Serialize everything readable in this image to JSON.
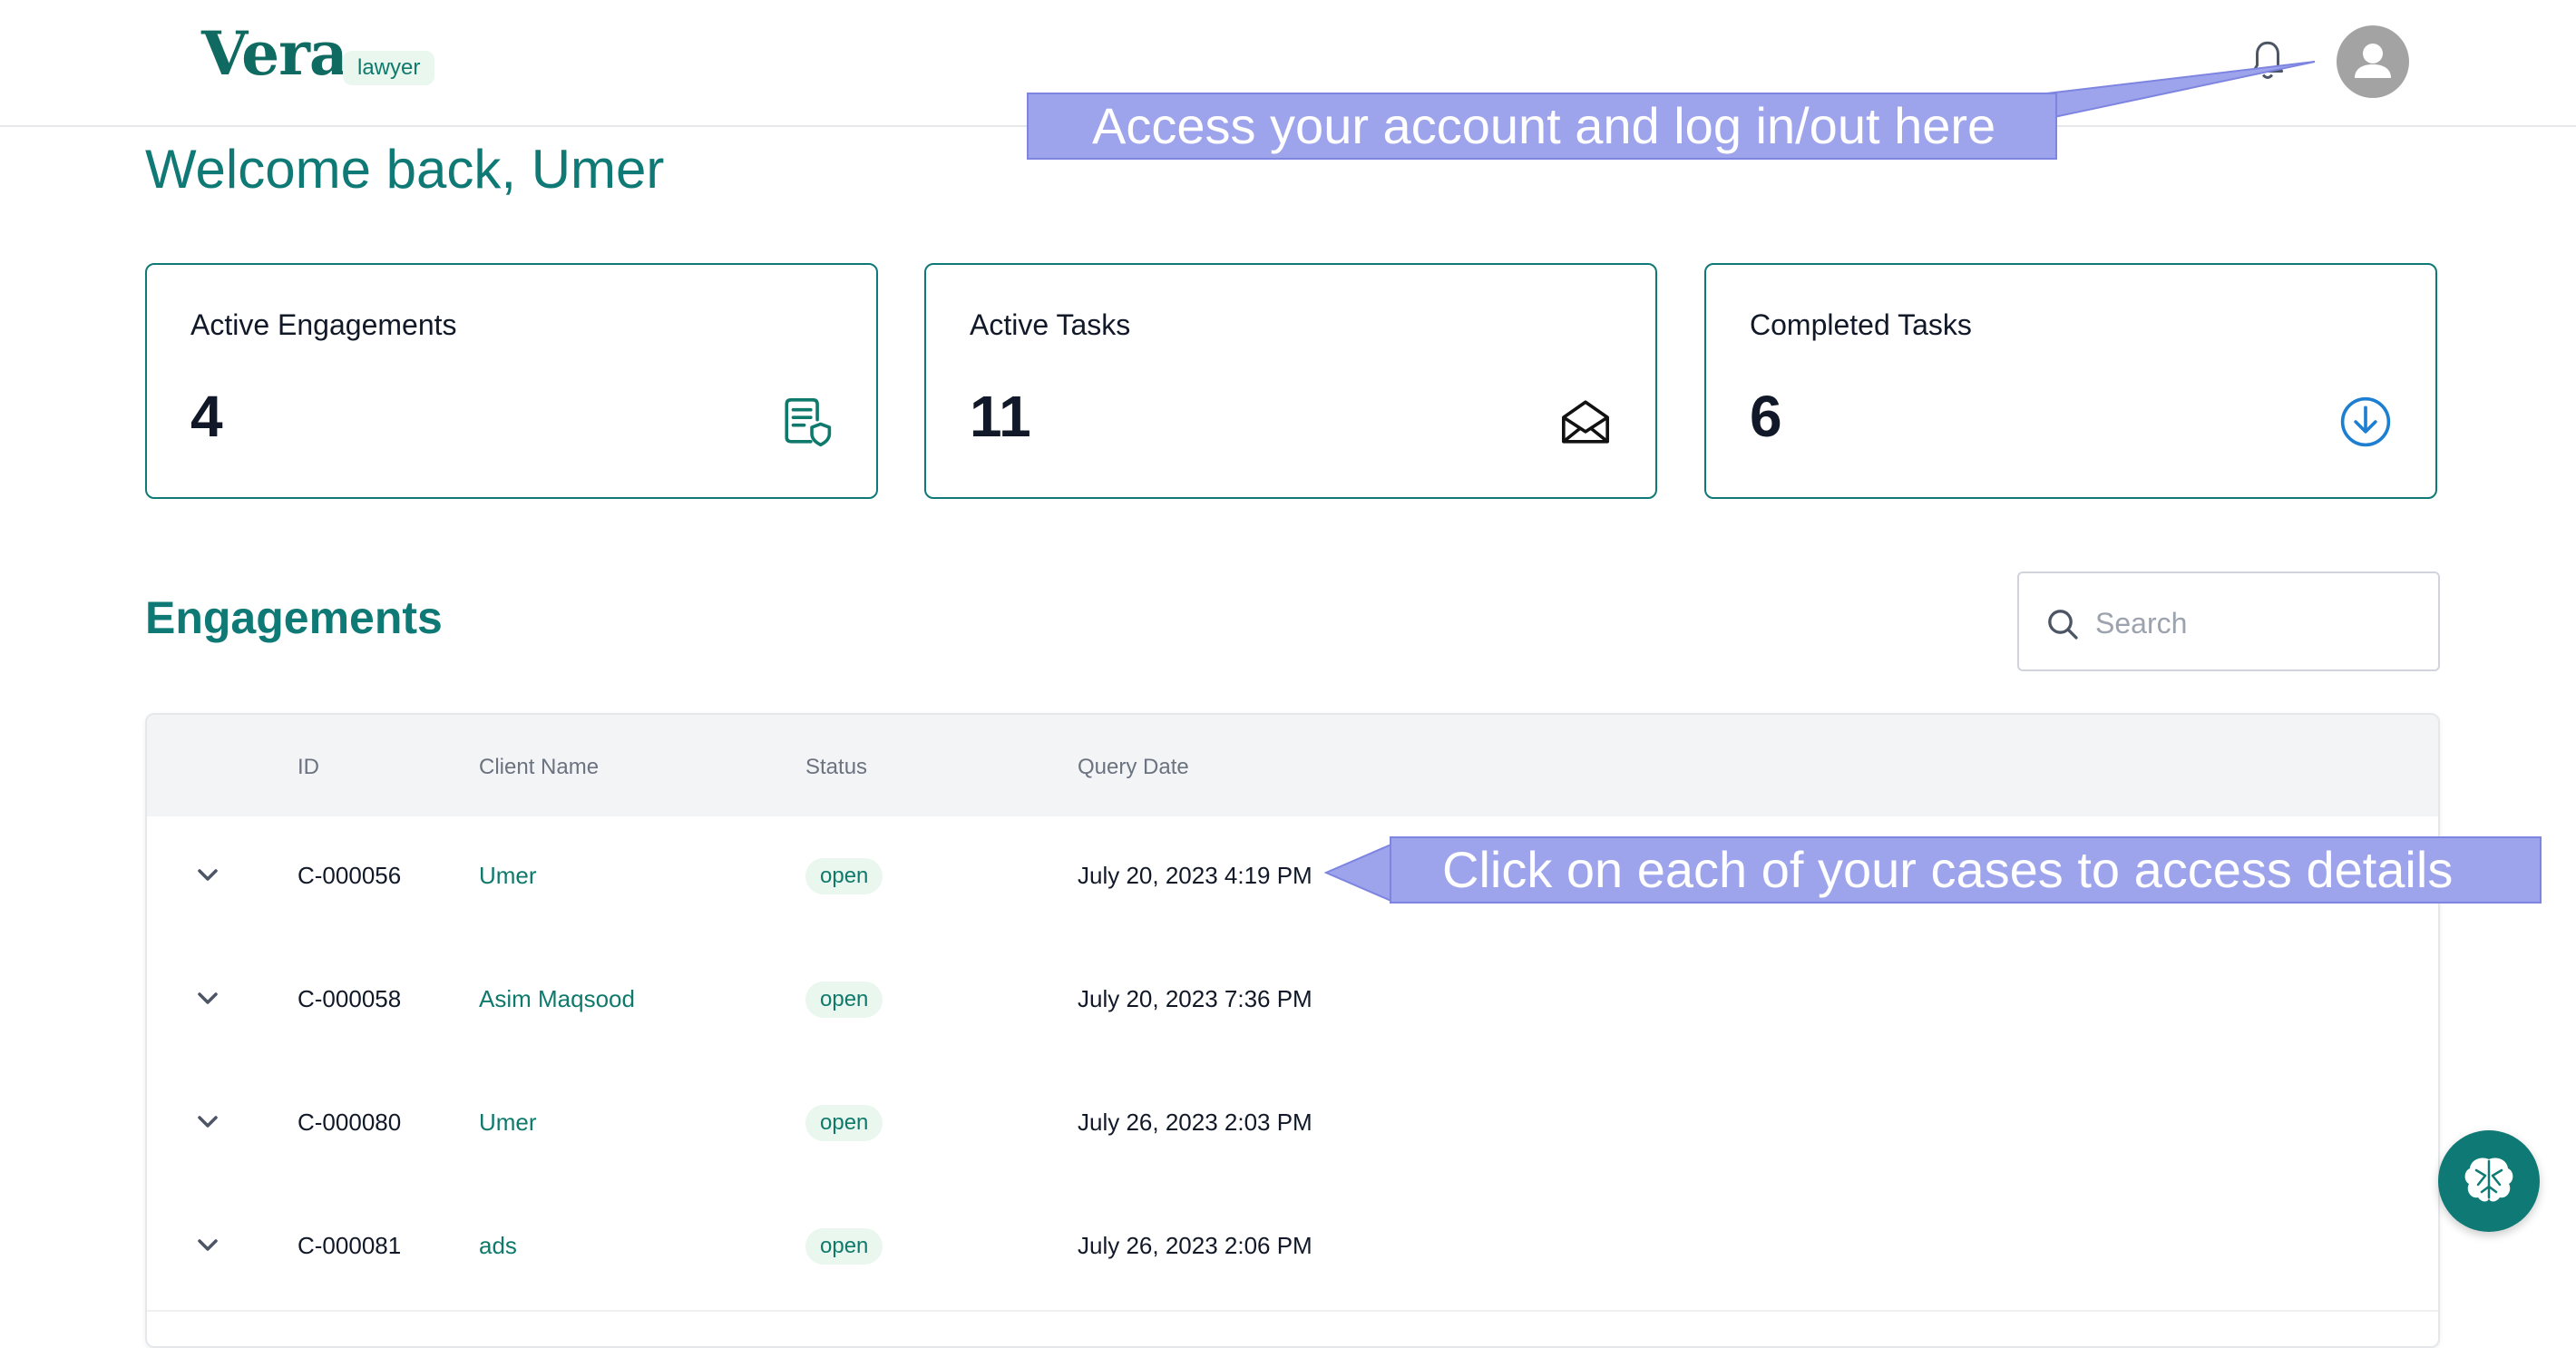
{
  "header": {
    "logo": "Vera",
    "role_badge": "lawyer",
    "bell_icon": "bell-icon",
    "avatar_icon": "user-avatar-icon"
  },
  "welcome": "Welcome back, Umer",
  "stats": [
    {
      "title": "Active Engagements",
      "value": "4",
      "icon": "document-shield-icon",
      "icon_color": "#0f7a6c"
    },
    {
      "title": "Active Tasks",
      "value": "11",
      "icon": "open-envelope-icon",
      "icon_color": "#111111"
    },
    {
      "title": "Completed Tasks",
      "value": "6",
      "icon": "download-circle-icon",
      "icon_color": "#1d7fd1"
    }
  ],
  "engagements": {
    "title": "Engagements",
    "search": {
      "placeholder": "Search",
      "value": ""
    },
    "columns": [
      "ID",
      "Client Name",
      "Status",
      "Query Date"
    ],
    "rows": [
      {
        "id": "C-000056",
        "client": "Umer",
        "status": "open",
        "date": "July 20, 2023 4:19 PM"
      },
      {
        "id": "C-000058",
        "client": "Asim Maqsood",
        "status": "open",
        "date": "July 20, 2023 7:36 PM"
      },
      {
        "id": "C-000080",
        "client": "Umer",
        "status": "open",
        "date": "July 26, 2023 2:03 PM"
      },
      {
        "id": "C-000081",
        "client": "ads",
        "status": "open",
        "date": "July 26, 2023 2:06 PM"
      }
    ]
  },
  "annotations": {
    "account": "Access your account and log in/out here",
    "cases": "Click on each of your cases to access details"
  },
  "chat_fab_icon": "brain-icon",
  "colors": {
    "brand": "#0f7a75",
    "annotation": "#9ea4ec",
    "status_bg": "#e9f7ee"
  }
}
